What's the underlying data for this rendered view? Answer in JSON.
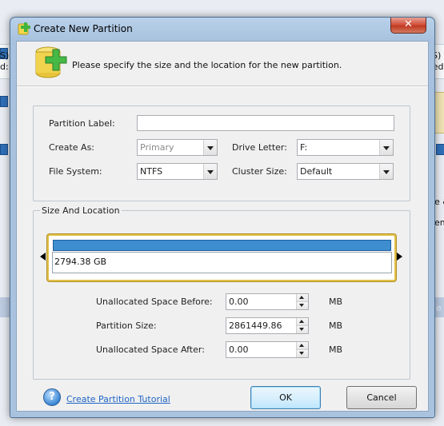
{
  "background": {
    "left_fragments": [
      "S)",
      "d:"
    ],
    "right_fragments": [
      "S)",
      "sed",
      "e &",
      "em",
      "e"
    ]
  },
  "dialog": {
    "title": "Create New Partition",
    "close_label": "✕",
    "header_text": "Please specify the size and the location for the new partition.",
    "fields": {
      "partition_label": {
        "label": "Partition Label:",
        "value": ""
      },
      "create_as": {
        "label": "Create As:",
        "value": "Primary"
      },
      "drive_letter": {
        "label": "Drive Letter:",
        "value": "F:"
      },
      "file_system": {
        "label": "File System:",
        "value": "NTFS"
      },
      "cluster_size": {
        "label": "Cluster Size:",
        "value": "Default"
      }
    },
    "size_group": {
      "title": "Size And Location",
      "map_text": "2794.38 GB",
      "unallocated_before": {
        "label": "Unallocated Space Before:",
        "value": "0.00",
        "unit": "MB"
      },
      "partition_size": {
        "label": "Partition Size:",
        "value": "2861449.86",
        "unit": "MB"
      },
      "unallocated_after": {
        "label": "Unallocated Space After:",
        "value": "0.00",
        "unit": "MB"
      }
    },
    "help_link": "Create Partition Tutorial",
    "ok_label": "OK",
    "cancel_label": "Cancel"
  },
  "colors": {
    "title_bar": "#b9d1ea",
    "close_button": "#c03a22",
    "partition_bar": "#3e8dd0",
    "map_frame": "#e2c046",
    "link": "#1f64c5"
  }
}
